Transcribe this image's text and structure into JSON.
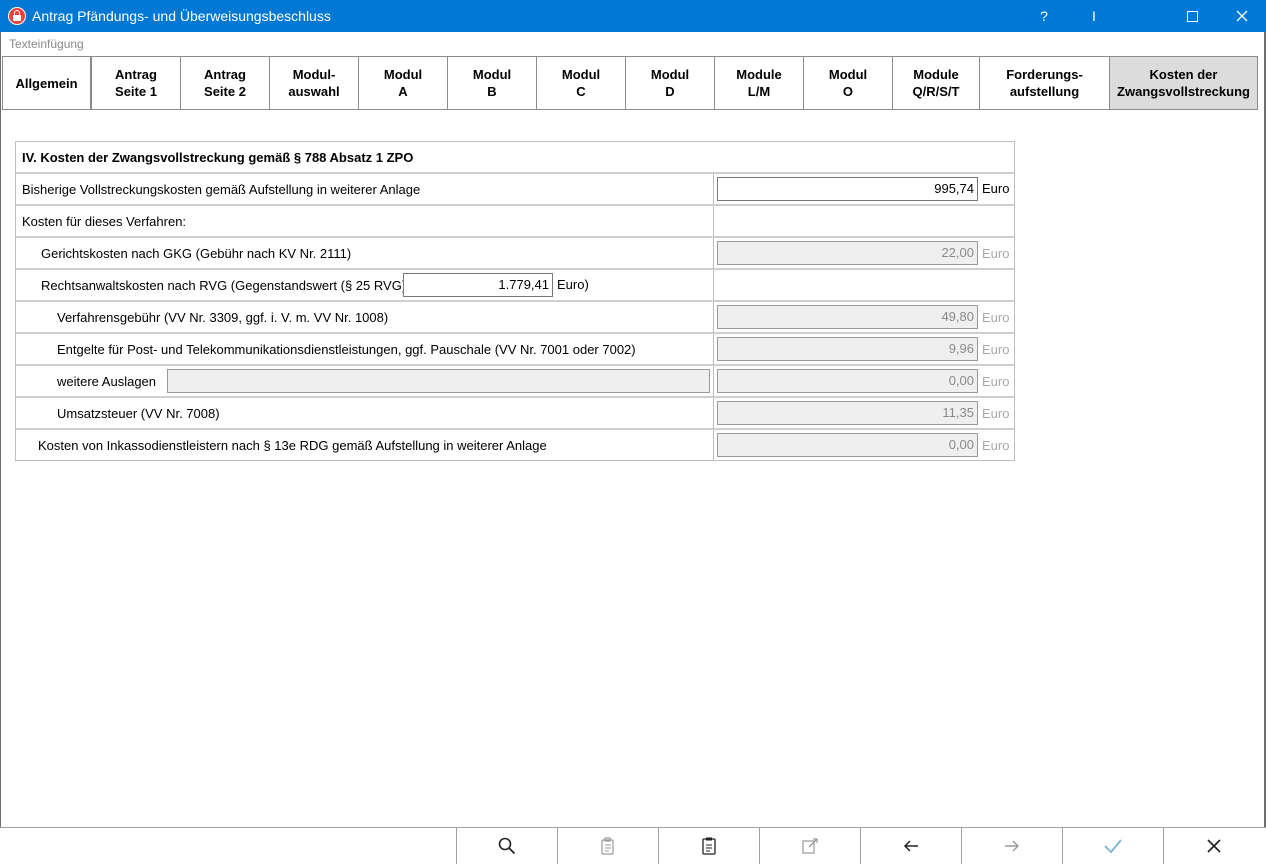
{
  "window": {
    "title": "Antrag Pfändungs- und Überweisungsbeschluss",
    "help": "?",
    "cursor_glyph": "I"
  },
  "menu": {
    "hint": "Texteinfügung"
  },
  "tabs": [
    {
      "label": "Allgemein"
    },
    {
      "label": "Antrag\nSeite 1"
    },
    {
      "label": "Antrag\nSeite 2"
    },
    {
      "label": "Modul-\nauswahl"
    },
    {
      "label": "Modul\nA"
    },
    {
      "label": "Modul\nB"
    },
    {
      "label": "Modul\nC"
    },
    {
      "label": "Modul\nD"
    },
    {
      "label": "Module\nL/M"
    },
    {
      "label": "Modul\nO"
    },
    {
      "label": "Module\nQ/R/S/T"
    },
    {
      "label": "Forderungs-\naufstellung"
    },
    {
      "label": "Kosten der\nZwangsvollstreckung",
      "active": true
    }
  ],
  "form": {
    "heading": "IV.  Kosten der Zwangsvollstreckung gemäß § 788 Absatz 1 ZPO",
    "bisherige_label": "Bisherige Vollstreckungskosten gemäß Aufstellung in weiterer Anlage",
    "bisherige_value": "995,74",
    "kosten_dieses_label": "Kosten für dieses Verfahren:",
    "gerichtskosten_label": "Gerichtskosten nach GKG (Gebühr nach KV Nr. 2111)",
    "gerichtskosten_value": "22,00",
    "rvg_label": "Rechtsanwaltskosten nach RVG (Gegenstandswert (§ 25 RVG):",
    "rvg_gegenstandswert": "1.779,41",
    "rvg_suffix": "Euro)",
    "verfahrensgebuehr_label": "Verfahrensgebühr (VV Nr. 3309, ggf. i. V. m. VV Nr. 1008)",
    "verfahrensgebuehr_value": "49,80",
    "entgelte_label": "Entgelte für Post- und Telekommunikationsdienstleistungen, ggf. Pauschale (VV Nr. 7001 oder 7002)",
    "entgelte_value": "9,96",
    "weitere_label": "weitere Auslagen",
    "weitere_text": "",
    "weitere_value": "0,00",
    "ust_label": "Umsatzsteuer (VV Nr. 7008)",
    "ust_value": "11,35",
    "inkasso_label": "Kosten von Inkassodienstleistern nach § 13e RDG gemäß Aufstellung in weiterer Anlage",
    "inkasso_value": "0,00",
    "unit": "Euro"
  },
  "toolbar": {
    "buttons": [
      "search-icon",
      "paste-icon",
      "document-icon",
      "edit-icon",
      "arrow-left-icon",
      "arrow-right-icon",
      "check-icon",
      "close-icon"
    ]
  },
  "colors": {
    "titlebar": "#0078d4",
    "active_tab": "#dcdcdc",
    "readonly_field": "#efefef",
    "check_accent": "#7ab6d6"
  }
}
